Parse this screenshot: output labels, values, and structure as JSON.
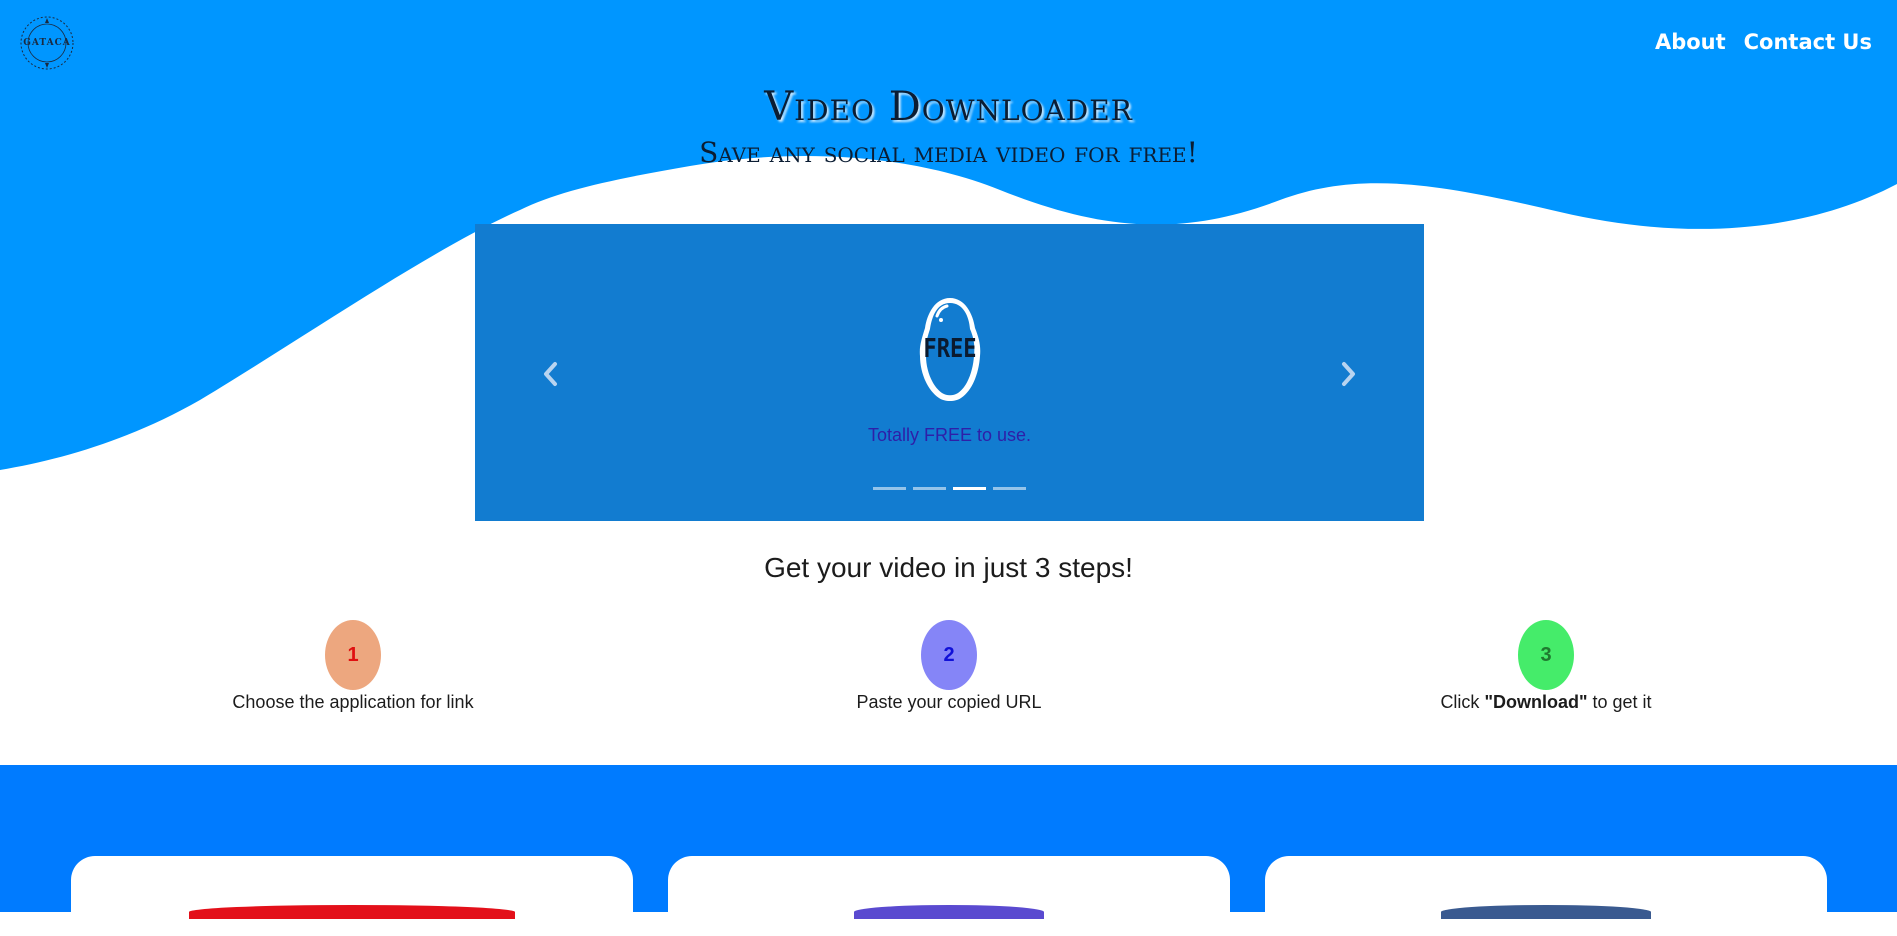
{
  "brand": {
    "logo_text": "GATACA"
  },
  "nav": {
    "about": "About",
    "contact": "Contact Us"
  },
  "hero": {
    "title": "Video Downloader",
    "subtitle": "Save any social media video for free!"
  },
  "carousel": {
    "badge_text": "FREE",
    "caption": "Totally FREE to use.",
    "slide_count": 4,
    "active_index": 2
  },
  "steps": {
    "heading": "Get your video in just 3 steps!",
    "items": [
      {
        "number": "1",
        "text": "Choose the application for link",
        "circle_color": "#eda77f",
        "number_color": "#e01010"
      },
      {
        "number": "2",
        "text": "Paste your copied URL",
        "circle_color": "#8585f7",
        "number_color": "#1010d8"
      },
      {
        "number": "3",
        "text_prefix": "Click ",
        "text_bold": "\"Download\"",
        "text_suffix": " to get it",
        "circle_color": "#45ec6a",
        "number_color": "#1f7a2f"
      }
    ]
  },
  "colors": {
    "hero_blue": "#0096ff",
    "carousel_blue": "#127cd0",
    "band_blue": "#007bff",
    "card_stripes": [
      "#e3101a",
      "#5a4ad0",
      "#3a5a90"
    ]
  }
}
